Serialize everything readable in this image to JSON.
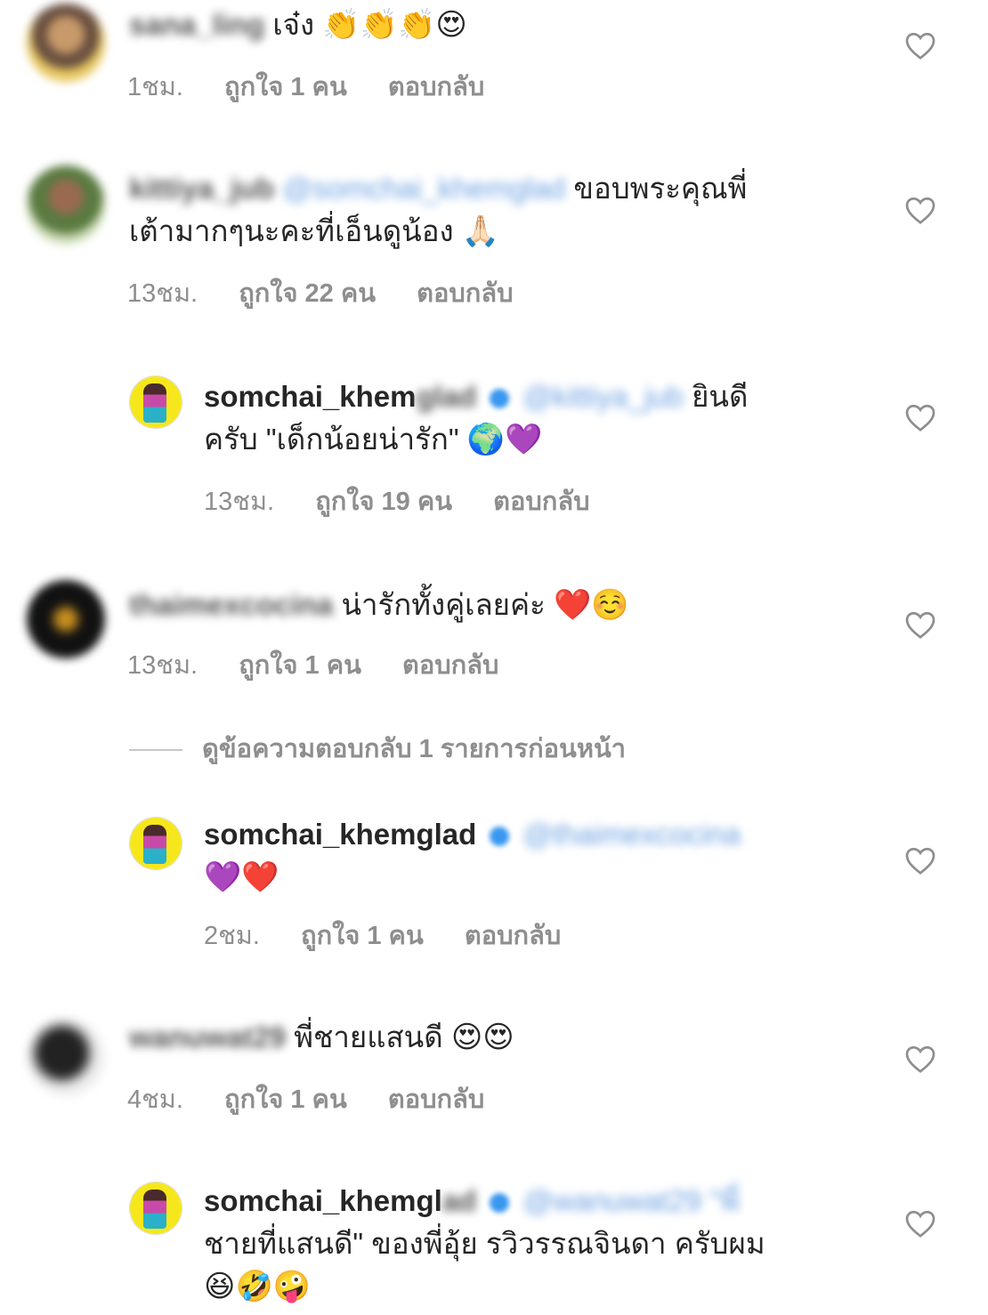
{
  "comments": [
    {
      "username": "sana_ling",
      "text": "เจ๋ง",
      "emoji": "👏👏👏😍",
      "time": "1ชม.",
      "likes": "ถูกใจ 1 คน",
      "reply": "ตอบกลับ"
    },
    {
      "username": "kittiya_jub",
      "mention": "@somchai_khemglad",
      "text1": "ขอบพระคุณพี่",
      "text2": "เต้ามากๆนะคะที่เอ็นดูน้อง",
      "emoji": "🙏🏻",
      "time": "13ชม.",
      "likes": "ถูกใจ 22 คน",
      "reply": "ตอบกลับ"
    },
    {
      "username": "somchai_khem",
      "username_blur": "glad",
      "mention": "@kittiya_jub",
      "text1": "ยินดี",
      "text2": "ครับ \"เด็กน้อยน่ารัก\"",
      "emoji": "🌍💜",
      "time": "13ชม.",
      "likes": "ถูกใจ 19 คน",
      "reply": "ตอบกลับ"
    },
    {
      "username": "thaimexcocina",
      "text": "น่ารักทั้งคู่เลยค่ะ",
      "emoji": "❤️☺️",
      "time": "13ชม.",
      "likes": "ถูกใจ 1 คน",
      "reply": "ตอบกลับ"
    },
    {
      "username": "somchai_khemglad",
      "mention": "@thaimexcocina",
      "emoji": "💜❤️",
      "time": "2ชม.",
      "likes": "ถูกใจ 1 คน",
      "reply": "ตอบกลับ"
    },
    {
      "username": "wanuwat29",
      "text": "พี่ชายแสนดี",
      "emoji": "😍😍",
      "time": "4ชม.",
      "likes": "ถูกใจ 1 คน",
      "reply": "ตอบกลับ"
    },
    {
      "username": "somchai_khemgl",
      "username_blur": "ad",
      "mention": "@wanuwat29 \"พี่",
      "text2": "ชายที่แสนดี\" ของพี่อุ้ย รวิวรรณจินดา ครับผม",
      "emoji": "😆🤣🤪"
    }
  ],
  "view_previous_replies": "ดูข้อความตอบกลับ 1 รายการก่อนหน้า",
  "icons": {
    "like": "heart-icon",
    "verified": "verified-badge-icon"
  },
  "colors": {
    "text": "#262626",
    "meta": "#8e8e8e",
    "link": "#3897f0",
    "avatar_yellow": "#f6e71d"
  }
}
